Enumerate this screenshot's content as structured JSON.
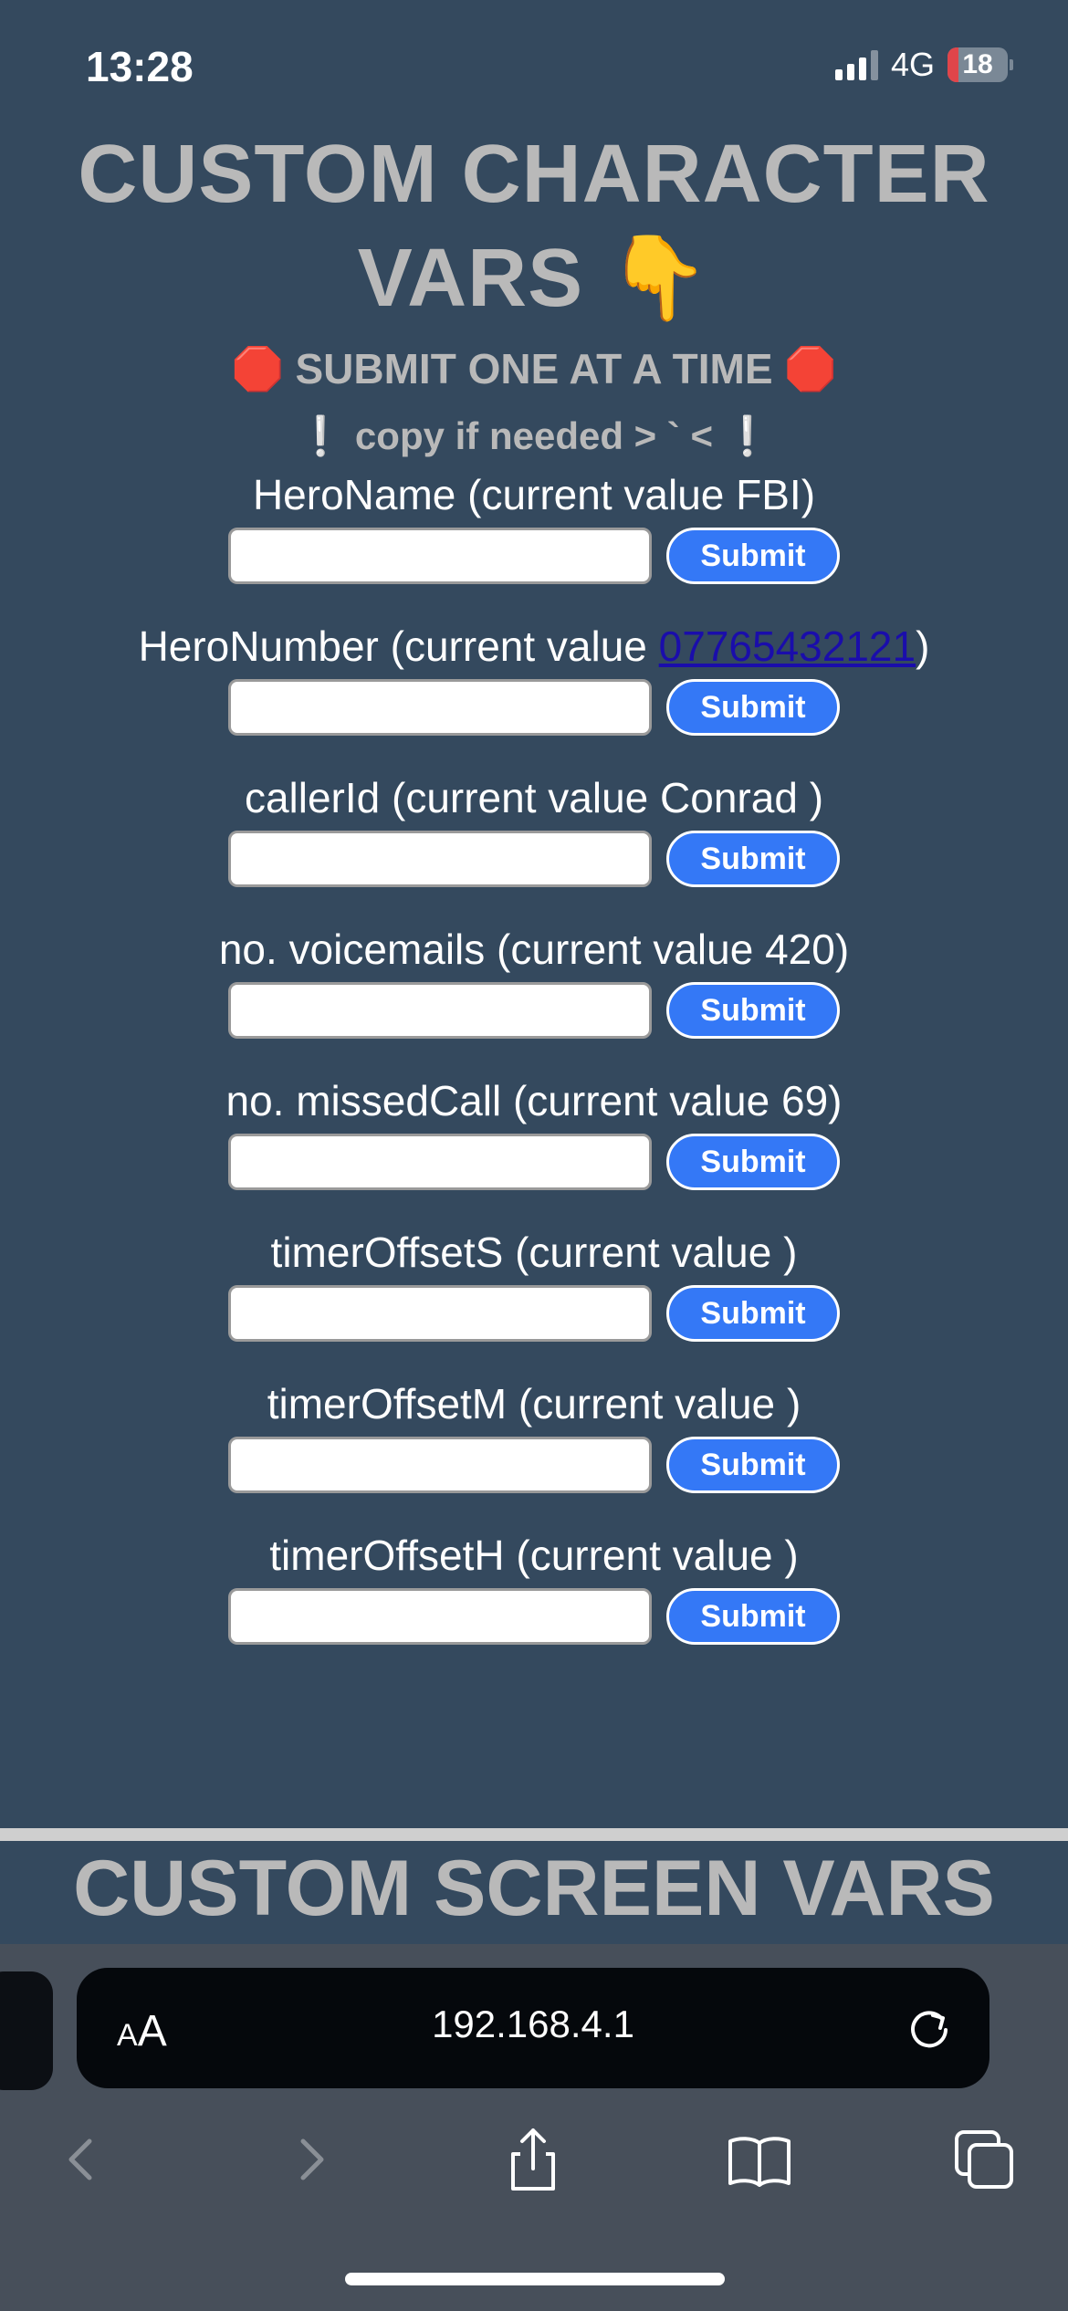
{
  "status": {
    "time": "13:28",
    "network": "4G",
    "battery": "18",
    "battery_level": 0.18
  },
  "page": {
    "title_line1": "CUSTOM CHARACTER",
    "title_line2": "VARS 👇",
    "warning": "🛑 SUBMIT ONE AT A TIME 🛑",
    "copy_note": "❕ copy if needed > ` < ❕",
    "submit_label": "Submit",
    "fields": [
      {
        "name": "HeroName",
        "prefix": "HeroName (current value ",
        "value": "FBI",
        "suffix": ")"
      },
      {
        "name": "HeroNumber",
        "prefix": "HeroNumber (current value ",
        "value": "07765432121",
        "suffix": ")"
      },
      {
        "name": "callerId",
        "prefix": "callerId (current value ",
        "value": "Conrad ",
        "suffix": ")"
      },
      {
        "name": "voicemails",
        "prefix": "no. voicemails (current value ",
        "value": "420",
        "suffix": ")"
      },
      {
        "name": "missedCall",
        "prefix": "no. missedCall (current value ",
        "value": "69",
        "suffix": ")"
      },
      {
        "name": "timerOffsetS",
        "prefix": "timerOffsetS (current value ",
        "value": "",
        "suffix": ")"
      },
      {
        "name": "timerOffsetM",
        "prefix": "timerOffsetM (current value ",
        "value": "",
        "suffix": ")"
      },
      {
        "name": "timerOffsetH",
        "prefix": "timerOffsetH (current value ",
        "value": "",
        "suffix": ")"
      }
    ],
    "screen_title": "CUSTOM SCREEN VARS"
  },
  "browser": {
    "aa_small": "A",
    "aa_large": "A",
    "url": "192.168.4.1"
  },
  "colors": {
    "background": "#34495e",
    "button": "#3478f6",
    "heading": "#b9b9b9",
    "link": "#1a0dab"
  },
  "icons": [
    "signal-icon",
    "battery-icon",
    "reload-icon",
    "back-icon",
    "forward-icon",
    "share-icon",
    "bookmarks-icon",
    "tabs-icon"
  ]
}
